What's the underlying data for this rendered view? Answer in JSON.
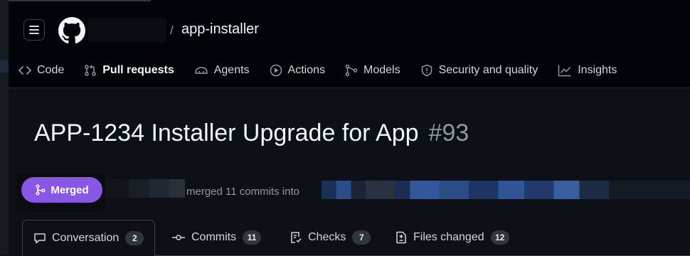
{
  "header": {
    "separator": "/",
    "repo_name": "app-installer"
  },
  "nav": [
    {
      "label": "Code",
      "icon": "code-icon"
    },
    {
      "label": "Pull requests",
      "icon": "git-pull-request-icon",
      "active": true
    },
    {
      "label": "Agents",
      "icon": "agent-icon"
    },
    {
      "label": "Actions",
      "icon": "play-icon"
    },
    {
      "label": "Models",
      "icon": "models-icon"
    },
    {
      "label": "Security and quality",
      "icon": "shield-icon"
    },
    {
      "label": "Insights",
      "icon": "graph-icon"
    }
  ],
  "pr": {
    "title": "APP-1234 Installer Upgrade for App",
    "number": "#93",
    "state": "Merged",
    "merge_text": "merged 11 commits into"
  },
  "tabs": [
    {
      "label": "Conversation",
      "count": "2",
      "icon": "comment-icon",
      "active": true
    },
    {
      "label": "Commits",
      "count": "11",
      "icon": "commit-icon"
    },
    {
      "label": "Checks",
      "count": "7",
      "icon": "checklist-icon"
    },
    {
      "label": "Files changed",
      "count": "12",
      "icon": "file-diff-icon"
    }
  ],
  "colors": {
    "background": "#0d1117",
    "header_bg": "#010409",
    "merged_badge": "#8957e5",
    "muted_text": "#9198a1"
  }
}
